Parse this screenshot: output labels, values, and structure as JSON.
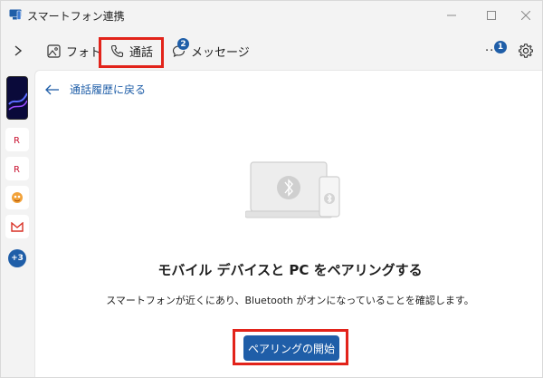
{
  "window": {
    "title": "スマートフォン連携",
    "controls": [
      "minimize",
      "maximize",
      "close"
    ]
  },
  "navbar": {
    "tabs": [
      {
        "label": "フォト",
        "icon": "photo-icon"
      },
      {
        "label": "通話",
        "icon": "phone-icon",
        "selected": true
      },
      {
        "label": "メッセージ",
        "icon": "message-icon",
        "badge": "2"
      }
    ],
    "notifications_badge": "1",
    "notifications_dots": "..."
  },
  "rail": {
    "more_label": "+3"
  },
  "content": {
    "back_label": "通話履歴に戻る",
    "heading": "モバイル デバイスと PC をペアリングする",
    "description": "スマートフォンが近くにあり、Bluetooth がオンになっていることを確認します。",
    "primary_button": "ペアリングの開始"
  },
  "colors": {
    "accent": "#1f5ea8",
    "highlight": "#e2231a",
    "background": "#f3f3f3"
  }
}
